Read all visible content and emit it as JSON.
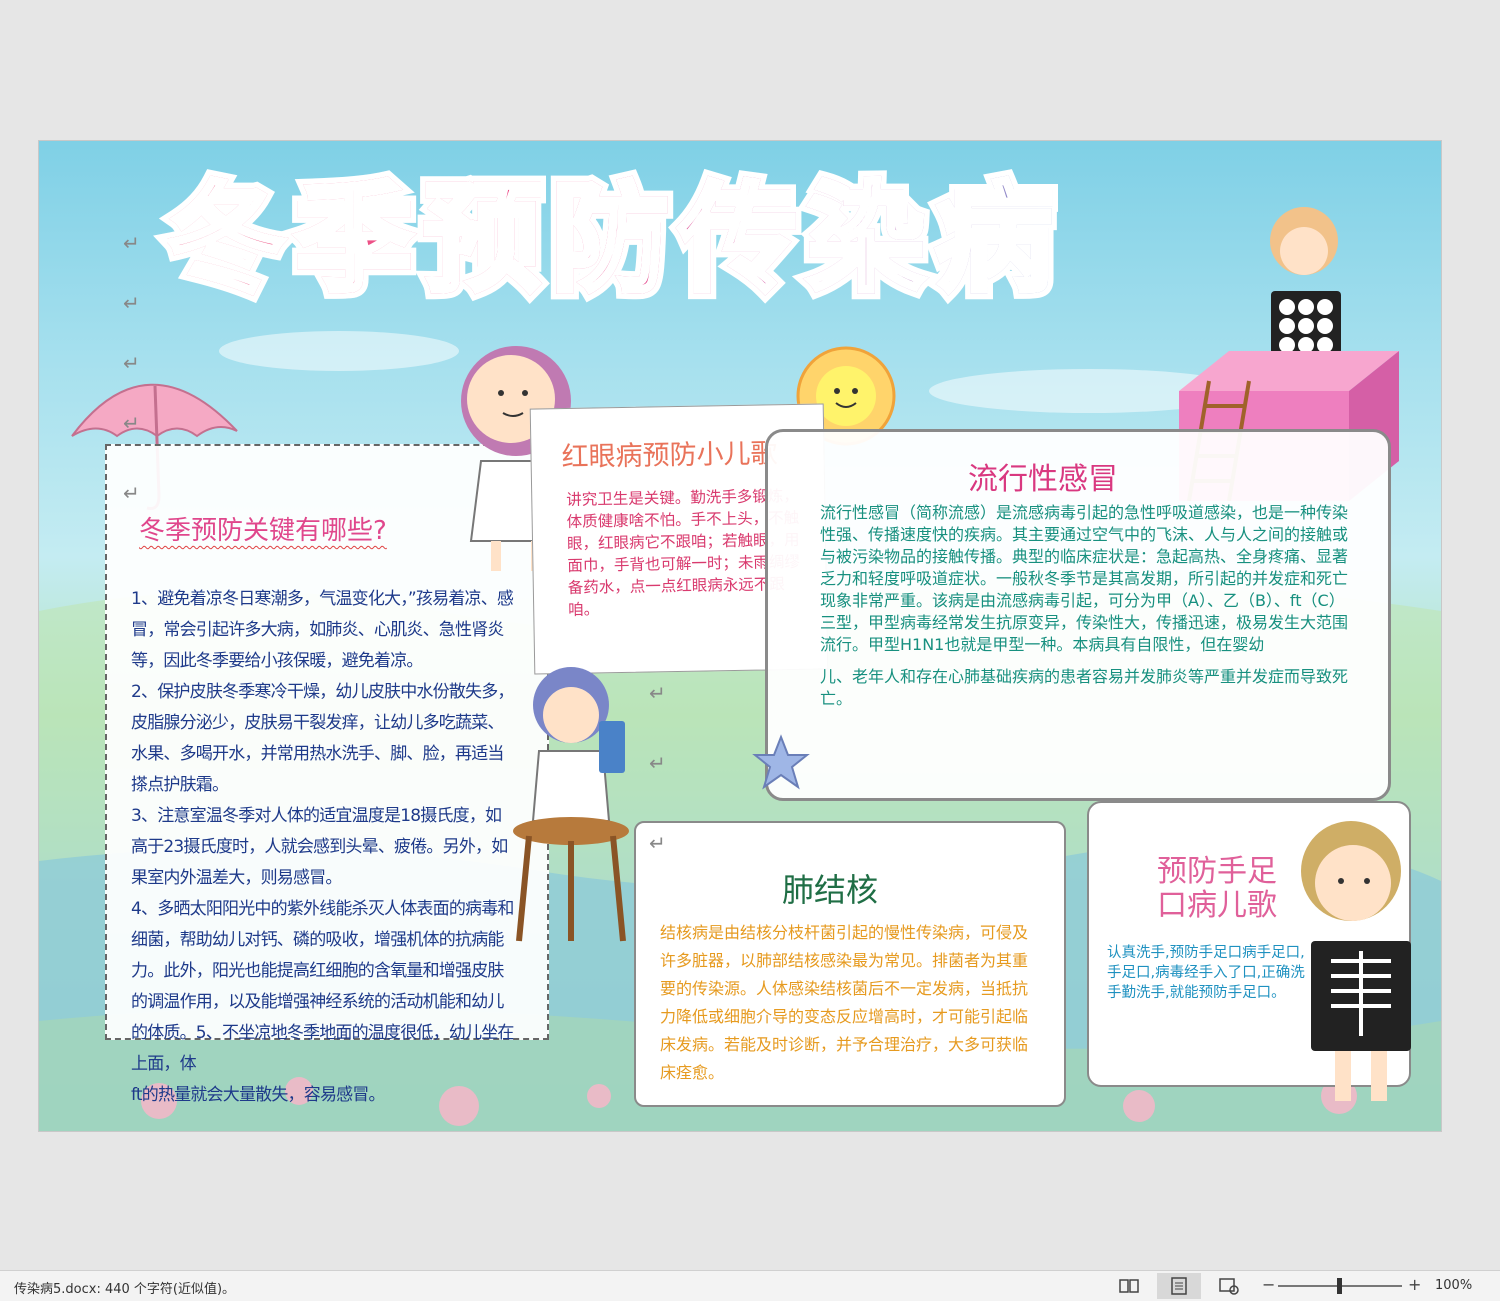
{
  "document": {
    "title": "冬季预防传染病",
    "left_card": {
      "heading": "冬季预防关键有哪些?",
      "paragraphs": [
        "1、避免着凉冬日寒潮多，气温变化大，”孩易着凉、感冒，常会引起许多大病，如肺炎、心肌炎、急性肾炎等，因此冬季要给小孩保暖，避免着凉。",
        "2、保护皮肤冬季寒冷干燥，幼儿皮肤中水份散失多，皮脂腺分泌少，皮肤易干裂发痒，让幼儿多吃蔬菜、水果、多喝开水，并常用热水洗手、脚、脸，再适当搽点护肤霜。",
        "3、注意室温冬季对人体的适宜温度是18摄氏度，如高于23摄氏度时，人就会感到头晕、疲倦。另外，如果室内外温差大，则易感冒。",
        "4、多晒太阳阳光中的紫外线能杀灭人体表面的病毒和细菌，帮助幼儿对钙、磷的吸收，增强机体的抗病能力。此外，阳光也能提高红细胞的含氧量和增强皮肤的调温作用，以及能增强神经系统的活动机能和幼儿的体质。5、不坐凉地冬季地面的温度很低，幼儿坐在上面，体",
        "ft的热量就会大量散失，容易感冒。"
      ]
    },
    "red_eye_card": {
      "title": "红眼病预防小儿歌",
      "body": "讲究卫生是关键。勤洗手多锻炼，体质健康啥不怕。手不上头，不触眼，红眼病它不跟咱；若触眼，用面巾，手背也可解一时；未雨绸缪备药水，点一点红眼病永远不跟咱。"
    },
    "flu_card": {
      "title": "流行性感冒",
      "body1": "流行性感冒（简称流感）是流感病毒引起的急性呼吸道感染，也是一种传染性强、传播速度快的疾病。其主要通过空气中的飞沫、人与人之间的接触或与被污染物品的接触传播。典型的临床症状是：急起高热、全身疼痛、显著乏力和轻度呼吸道症状。一般秋冬季节是其高发期，所引起的并发症和死亡现象非常严重。该病是由流感病毒引起，可分为甲（A）、乙（B）、ft（C）三型，甲型病毒经常发生抗原变异，传染性大，传播迅速，极易发生大范围流行。甲型H1N1也就是甲型一种。本病具有自限性，但在婴幼",
      "body2": "儿、老年人和存在心肺基础疾病的患者容易并发肺炎等严重并发症而导致死亡。"
    },
    "tb_card": {
      "title": "肺结核",
      "body": "结核病是由结核分枝杆菌引起的慢性传染病，可侵及许多脏器，以肺部结核感染最为常见。排菌者为其重要的传染源。人体感染结核菌后不一定发病，当抵抗力降低或细胞介导的变态反应增高时，才可能引起临床发病。若能及时诊断，并予合理治疗，大多可获临床痊愈。"
    },
    "hfm_card": {
      "title": "预防手足口病儿歌",
      "body": "认真洗手,预防手足口病手足口,手足口,病毒经手入了口,正确洗手勤洗手,就能预防手足口。"
    },
    "paragraph_mark": "↵"
  },
  "status_bar": {
    "text": "传染病5.docx: 440 个字符(近似值)。",
    "zoom_minus": "−",
    "zoom_plus": "+",
    "zoom_label": "100%",
    "zoom_percent": 100,
    "icons": [
      "read-mode-icon",
      "print-layout-icon",
      "web-layout-icon"
    ]
  },
  "colors": {
    "title_gradient": [
      "#f06a8f",
      "#e9357c",
      "#c766b5",
      "#45c2e8"
    ],
    "left_heading": "#e0478c",
    "left_body": "#1e3a8a",
    "red_eye_title": "#e9735a",
    "red_eye_body": "#d93a6e",
    "flu_title": "#d93880",
    "flu_body": "#17907f",
    "tb_title": "#1f6e45",
    "tb_body": "#e69a1f",
    "hfm_title": "#e0609a",
    "hfm_body": "#1e91c0"
  }
}
